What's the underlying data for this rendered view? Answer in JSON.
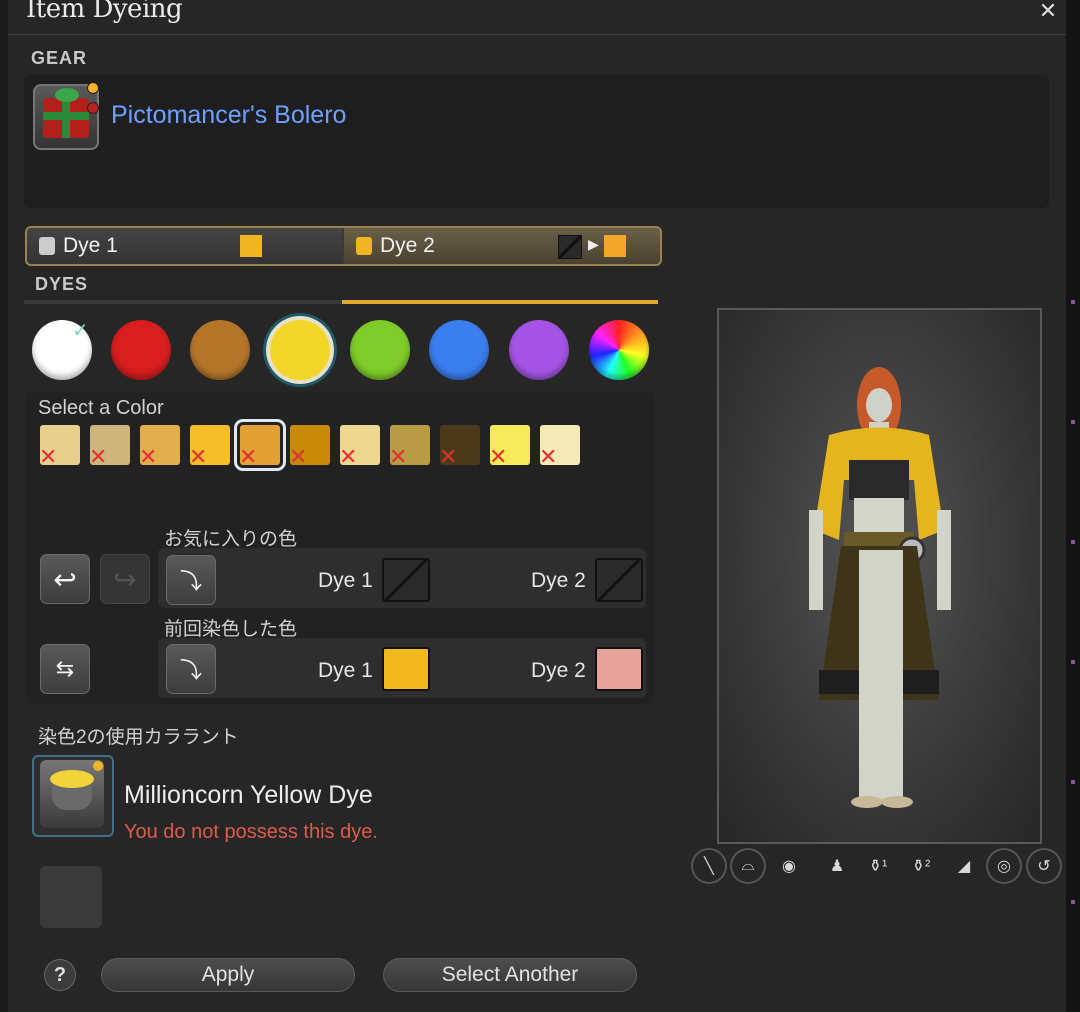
{
  "window": {
    "title": "Item Dyeing"
  },
  "gear": {
    "section_label": "GEAR",
    "item_name": "Pictomancer's Bolero",
    "icon": "gift-box-icon"
  },
  "dye_tabs": {
    "dye1_label": "Dye 1",
    "dye2_label": "Dye 2",
    "dye1_color": "#f2b522",
    "dye2_color": "#f2a72a",
    "active": "Dye 2"
  },
  "dyes": {
    "section_label": "DYES",
    "categories": [
      {
        "name": "white",
        "color": "#ffffff"
      },
      {
        "name": "red",
        "color": "#d81e1e"
      },
      {
        "name": "brown",
        "color": "#b5762a"
      },
      {
        "name": "yellow",
        "color": "#f2d72a"
      },
      {
        "name": "green",
        "color": "#7fcc2a"
      },
      {
        "name": "blue",
        "color": "#3a7eef"
      },
      {
        "name": "purple",
        "color": "#a554e6"
      },
      {
        "name": "rainbow",
        "color": "rainbow"
      }
    ],
    "selected_category": "yellow",
    "select_label": "Select a Color",
    "shades": [
      "#e9cf8e",
      "#cdb57c",
      "#e3ae4c",
      "#f6bd2a",
      "#e2a035",
      "#c98a08",
      "#eed790",
      "#b99c47",
      "#4a3a1a",
      "#f6e95a",
      "#f5e9b6"
    ],
    "selected_shade_index": 4
  },
  "favorites": {
    "label": "お気に入りの色",
    "dye1_label": "Dye 1",
    "dye2_label": "Dye 2"
  },
  "previous": {
    "label": "前回染色した色",
    "dye1_label": "Dye 1",
    "dye2_label": "Dye 2",
    "dye1_color": "#f2b91e",
    "dye2_color": "#e7a29b"
  },
  "colorant": {
    "label": "染色2の使用カララント",
    "item_name": "Millioncorn Yellow Dye",
    "warning": "You do not possess this dye."
  },
  "buttons": {
    "help": "?",
    "apply": "Apply",
    "select_another": "Select Another"
  },
  "preview_toolbar": [
    "weapon-icon",
    "hat-icon",
    "emote-icon",
    "character-icon",
    "dye1-icon",
    "dye2-icon",
    "lighting-icon",
    "eye-icon",
    "reset-icon"
  ]
}
